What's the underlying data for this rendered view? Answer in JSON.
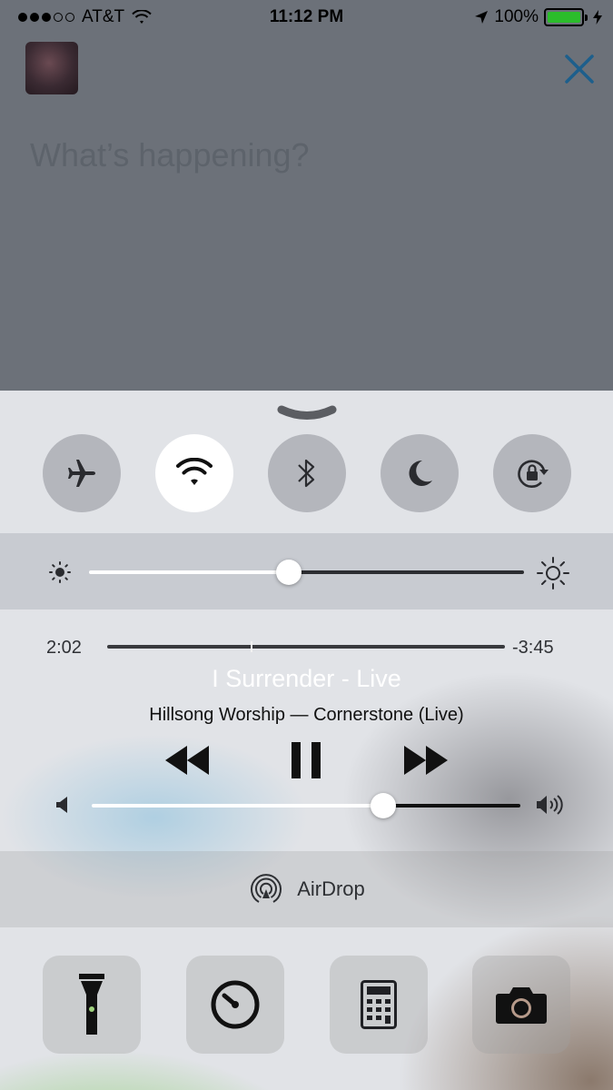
{
  "status_bar": {
    "carrier": "AT&T",
    "signal_bars_filled": 3,
    "signal_bars_total": 5,
    "time": "11:12 PM",
    "battery_percent": "100%",
    "battery_color": "#2bbd2b"
  },
  "compose": {
    "placeholder": "What’s happening?",
    "close_color": "#1d5f8c"
  },
  "control_center": {
    "toggles": [
      {
        "name": "airplane-mode",
        "icon": "airplane-icon",
        "active": false
      },
      {
        "name": "wifi",
        "icon": "wifi-icon",
        "active": true
      },
      {
        "name": "bluetooth",
        "icon": "bluetooth-icon",
        "active": false
      },
      {
        "name": "do-not-disturb",
        "icon": "moon-icon",
        "active": false
      },
      {
        "name": "rotation-lock",
        "icon": "rotation-lock-icon",
        "active": false
      }
    ],
    "brightness_level": 0.46,
    "media": {
      "elapsed": "2:02",
      "remaining": "-3:45",
      "progress": 0.36,
      "title": "I Surrender - Live",
      "artist_album": "Hillsong Worship — Cornerstone (Live)",
      "volume_level": 0.68
    },
    "airdrop_label": "AirDrop",
    "quick_actions": [
      "flashlight-icon",
      "timer-icon",
      "calculator-icon",
      "camera-icon"
    ]
  }
}
